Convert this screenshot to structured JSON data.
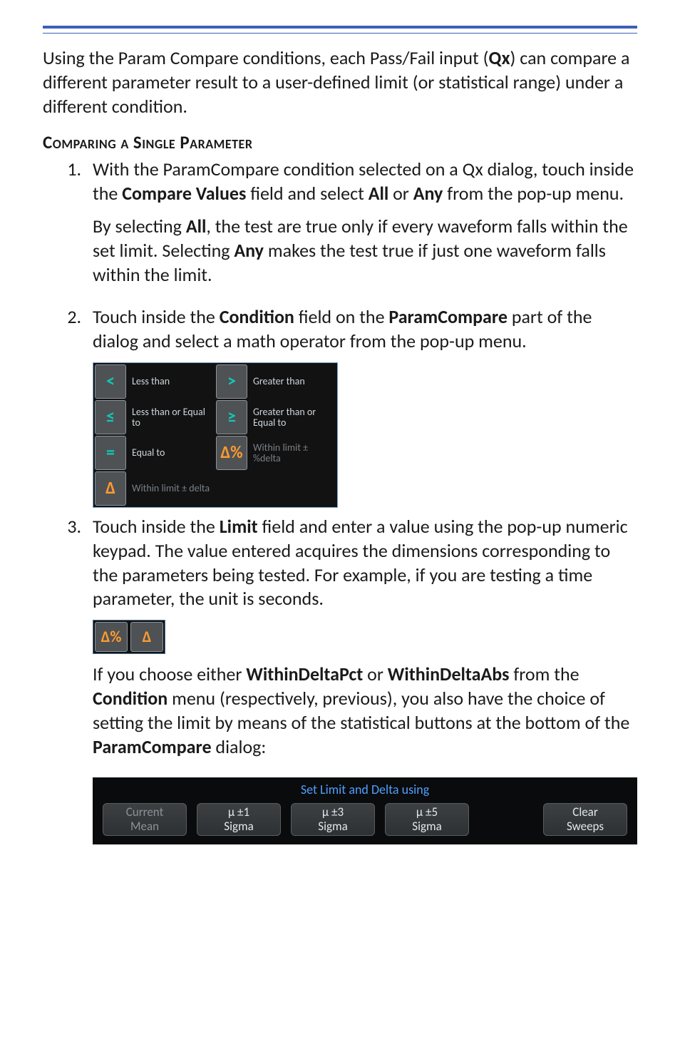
{
  "intro": "Using the Param Compare conditions, each Pass/Fail input (<b>Qx</b>) can compare a different parameter result to a user-defined limit (or statistical range) under a different condition.",
  "heading": "Comparing a Single Parameter",
  "step1": {
    "para": "With the ParamCompare condition selected on a Qx dialog, touch inside the <b>Compare Values</b> field and select <b>All</b> or <b>Any</b> from the pop-up menu.",
    "sub": "By selecting <b>All</b>, the test are true only if every waveform falls within the set limit. Selecting <b>Any</b> makes the test true if just one waveform falls within the limit."
  },
  "step2": {
    "para": "Touch inside the <b>Condition</b> field on the <b>ParamCompare</b> part of the dialog and select a math operator from the pop-up menu.",
    "operators": [
      {
        "icon": "lt",
        "icon_color": "teal",
        "label": "Less than",
        "label_muted": false
      },
      {
        "icon": "gt",
        "icon_color": "teal",
        "label": "Greater than",
        "label_muted": false
      },
      {
        "icon": "le",
        "icon_color": "teal",
        "label": "Less than or Equal to",
        "label_muted": false
      },
      {
        "icon": "ge",
        "icon_color": "teal",
        "label": "Greater than or Equal to",
        "label_muted": false
      },
      {
        "icon": "eq",
        "icon_color": "teal",
        "label": "Equal to",
        "label_muted": false
      },
      {
        "icon": "dpct",
        "icon_color": "orange",
        "label": "Within limit ± %delta",
        "label_muted": true
      },
      {
        "icon": "dabs",
        "icon_color": "orange",
        "label": "Within limit ± delta",
        "label_muted": true
      }
    ]
  },
  "step3": {
    "para": "Touch inside the <b>Limit</b> field and enter a value using the pop-up numeric keypad. The value entered acquires the dimensions corresponding to the parameters being tested. For example, if you are testing a time parameter, the unit is seconds.",
    "mini_icons": [
      "dpct",
      "dabs"
    ],
    "sub": "If you choose either <b>WithinDeltaPct</b> or <b>WithinDeltaAbs</b> from the <b>Condition</b> menu (respectively, previous), you also have the choice of setting the limit by means of the statistical buttons at the bottom of the <b>ParamCompare</b> dialog:"
  },
  "darkbar": {
    "title": "Set Limit and Delta using",
    "buttons": [
      {
        "l1": "Current",
        "l2": "Mean",
        "dim": true
      },
      {
        "l1": "µ ±1",
        "l2": "Sigma",
        "dim": false
      },
      {
        "l1": "µ ±3",
        "l2": "Sigma",
        "dim": false
      },
      {
        "l1": "µ ±5",
        "l2": "Sigma",
        "dim": false
      },
      {
        "l1": "Clear",
        "l2": "Sweeps",
        "dim": false
      }
    ]
  },
  "icon_glyphs": {
    "lt": "<",
    "gt": ">",
    "le": "≤",
    "ge": "≥",
    "eq": "=",
    "dpct": "Δ%",
    "dabs": "Δ"
  }
}
